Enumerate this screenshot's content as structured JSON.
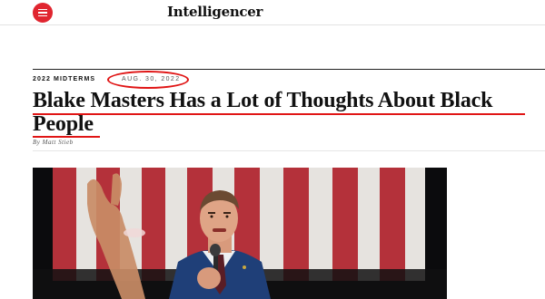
{
  "header": {
    "brand": "Intelligencer",
    "menu_icon": "hamburger-menu-icon",
    "accent_color": "#e0252f"
  },
  "article": {
    "kicker": "2022 MIDTERMS",
    "date": "AUG. 30, 2022",
    "headline": "Blake Masters Has a Lot of Thoughts About Black People",
    "byline": "By Matt Stieb"
  },
  "annotations": {
    "highlight_color": "#e01515"
  }
}
